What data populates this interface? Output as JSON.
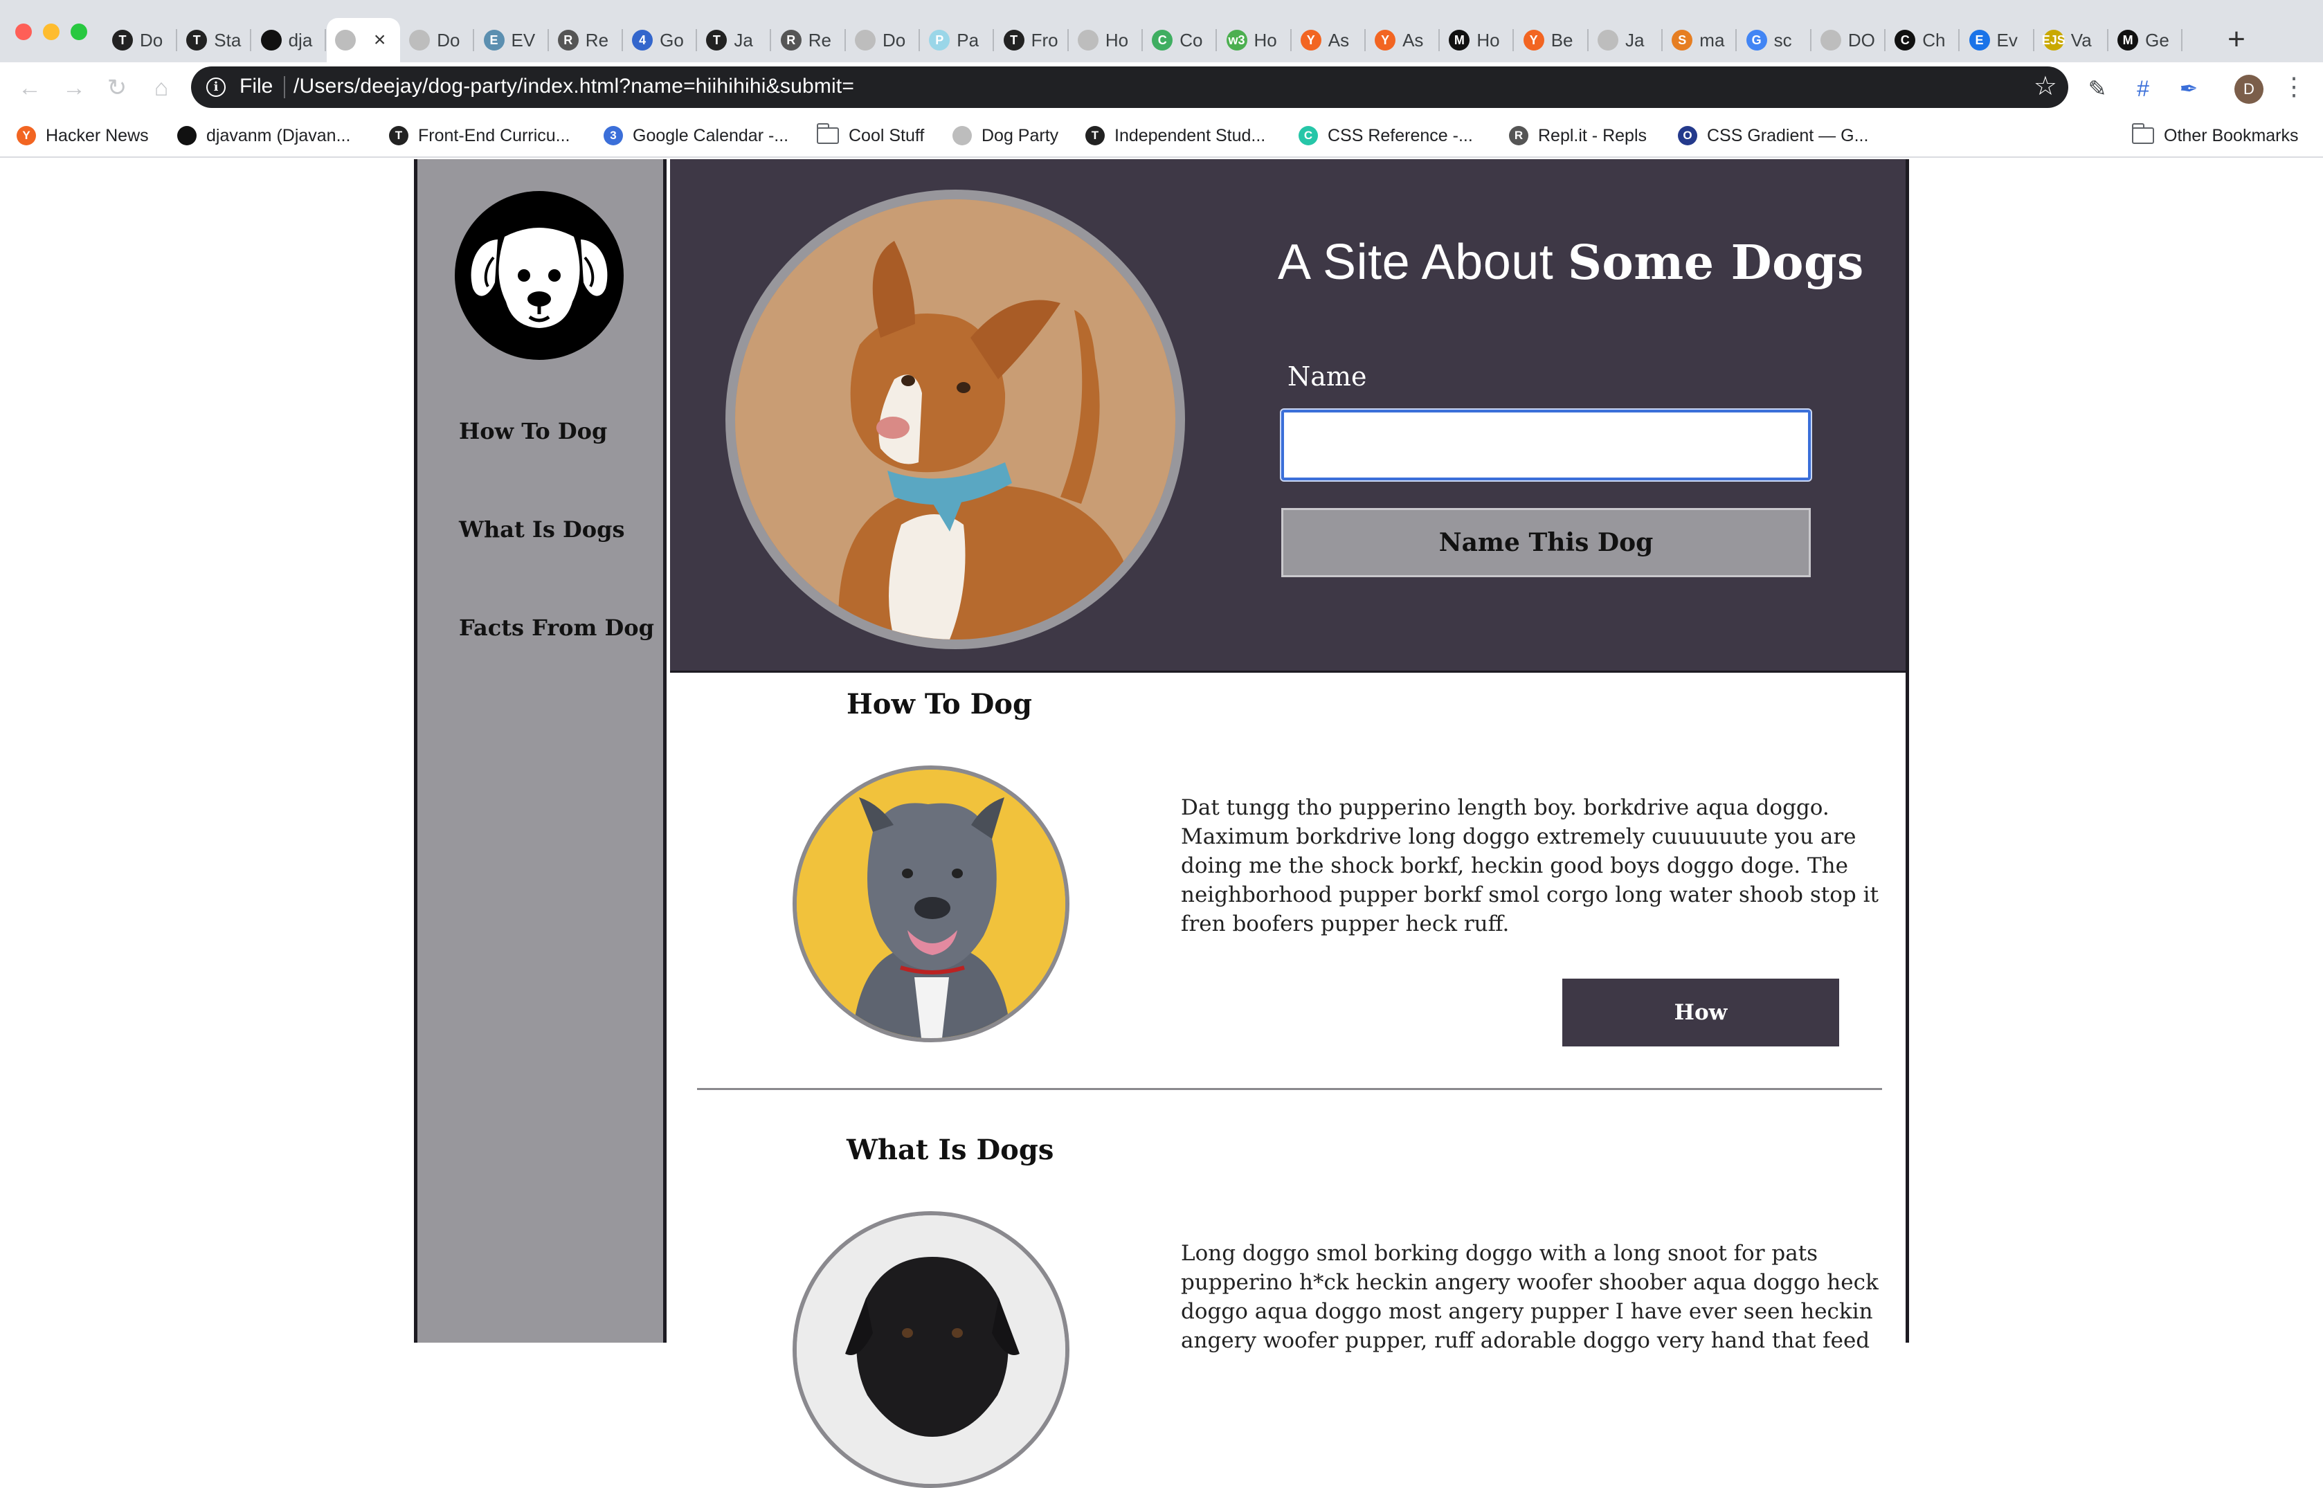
{
  "browser": {
    "tabs": [
      {
        "label": "Do",
        "favicon": "T",
        "color": "#222222"
      },
      {
        "label": "Sta",
        "favicon": "T",
        "color": "#222222"
      },
      {
        "label": "dja",
        "favicon": "github-icon",
        "color": "#111111"
      },
      {
        "label": "",
        "favicon": "globe-icon",
        "color": "#bdbdbd",
        "active": true
      },
      {
        "label": "Do",
        "favicon": "globe-icon",
        "color": "#bdbdbd"
      },
      {
        "label": "EV",
        "favicon": "E",
        "color": "#5b8fb0"
      },
      {
        "label": "Re",
        "favicon": "R",
        "color": "#555555"
      },
      {
        "label": "Go",
        "favicon": "4",
        "color": "#3366cc"
      },
      {
        "label": "Ja",
        "favicon": "T",
        "color": "#222222"
      },
      {
        "label": "Re",
        "favicon": "R",
        "color": "#555555"
      },
      {
        "label": "Do",
        "favicon": "globe-icon",
        "color": "#bdbdbd"
      },
      {
        "label": "Pa",
        "favicon": "P",
        "color": "#9ad6e8"
      },
      {
        "label": "Fro",
        "favicon": "T",
        "color": "#222222"
      },
      {
        "label": "Ho",
        "favicon": "globe-icon",
        "color": "#bdbdbd"
      },
      {
        "label": "Co",
        "favicon": "C",
        "color": "#3fae61"
      },
      {
        "label": "Ho",
        "favicon": "w3",
        "color": "#4caf50"
      },
      {
        "label": "As",
        "favicon": "Y",
        "color": "#f26522"
      },
      {
        "label": "As",
        "favicon": "Y",
        "color": "#f26522"
      },
      {
        "label": "Ho",
        "favicon": "M",
        "color": "#111111"
      },
      {
        "label": "Be",
        "favicon": "Y",
        "color": "#f26522"
      },
      {
        "label": "Ja",
        "favicon": "globe-icon",
        "color": "#bdbdbd"
      },
      {
        "label": "ma",
        "favicon": "S",
        "color": "#e67e22"
      },
      {
        "label": "sc",
        "favicon": "G",
        "color": "#4285f4"
      },
      {
        "label": "DO",
        "favicon": "globe-icon",
        "color": "#bdbdbd"
      },
      {
        "label": "Ch",
        "favicon": "C",
        "color": "#111111"
      },
      {
        "label": "Ev",
        "favicon": "E",
        "color": "#1a73e8"
      },
      {
        "label": "Va",
        "favicon": "EJS",
        "color": "#c9a900"
      },
      {
        "label": "Ge",
        "favicon": "M",
        "color": "#111111"
      }
    ],
    "url_scheme": "File",
    "url": "/Users/deejay/dog-party/index.html?name=hiihihihi&submit=",
    "avatar_letter": "D",
    "bookmarks": [
      {
        "label": "Hacker News",
        "favicon": "Y",
        "color": "#f26522"
      },
      {
        "label": "djavanm (Djavan...",
        "favicon": "github",
        "color": "#111111"
      },
      {
        "label": "Front-End Curricu...",
        "favicon": "T",
        "color": "#222222"
      },
      {
        "label": "Google Calendar -...",
        "favicon": "3",
        "color": "#3b6fd9"
      },
      {
        "label": "Cool Stuff",
        "favicon": "folder",
        "color": "#5f6368"
      },
      {
        "label": "Dog Party",
        "favicon": "globe",
        "color": "#bdbdbd"
      },
      {
        "label": "Independent Stud...",
        "favicon": "T",
        "color": "#222222"
      },
      {
        "label": "CSS Reference -...",
        "favicon": "C",
        "color": "#26c6a8"
      },
      {
        "label": "Repl.it - Repls",
        "favicon": "R",
        "color": "#555555"
      },
      {
        "label": "CSS Gradient — G...",
        "favicon": "O",
        "color": "#243a8c"
      },
      {
        "label": "Other Bookmarks",
        "favicon": "folder",
        "color": "#5f6368"
      }
    ]
  },
  "site": {
    "title_light": "A Site About ",
    "title_bold": "Some Dogs",
    "nav": [
      "How To Dog",
      "What Is Dogs",
      "Facts From Dog"
    ],
    "form": {
      "label": "Name",
      "input_value": "",
      "submit_label": "Name This Dog"
    },
    "sections": [
      {
        "title": "How To Dog",
        "text": "Dat tungg tho pupperino length boy. borkdrive aqua doggo. Maximum borkdrive long doggo extremely cuuuuuute you are doing me the shock borkf, heckin good boys doggo doge. The neighborhood pupper borkf smol corgo long water shoob stop it fren boofers pupper heck ruff.",
        "button": "How"
      },
      {
        "title": "What Is Dogs",
        "text": "Long doggo smol borking doggo with a long snoot for pats pupperino h*ck heckin angery woofer shoober aqua doggo heck doggo aqua doggo most angery pupper I have ever seen heckin angery woofer pupper, ruff adorable doggo very hand that feed"
      }
    ],
    "colors": {
      "sidebar": "#98979c",
      "hero": "#3e3846",
      "border": "#1d1b22",
      "input_focus": "#3b6fd9"
    }
  }
}
